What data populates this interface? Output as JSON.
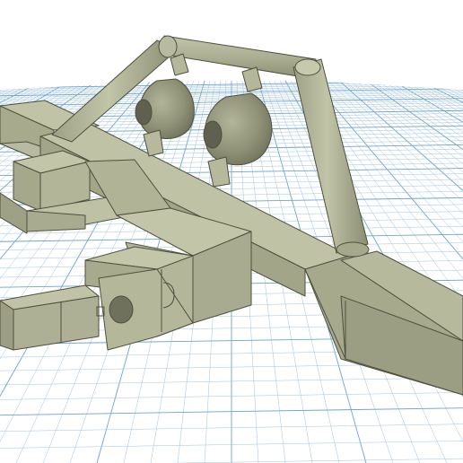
{
  "viewport": {
    "background": "#ffffff",
    "grid_color": "#9fc3de",
    "grid_major_color": "#6fa3cc",
    "model_face_light": "#b9bba0",
    "model_face_mid": "#a8aa8e",
    "model_face_dark": "#8e9076",
    "model_edge": "#4e503e"
  },
  "model": {
    "part_name": "",
    "parts": [
      "front-bumper",
      "bull-bar",
      "left-light-pod",
      "right-light-pod",
      "mount-bracket",
      "side-rail"
    ]
  }
}
